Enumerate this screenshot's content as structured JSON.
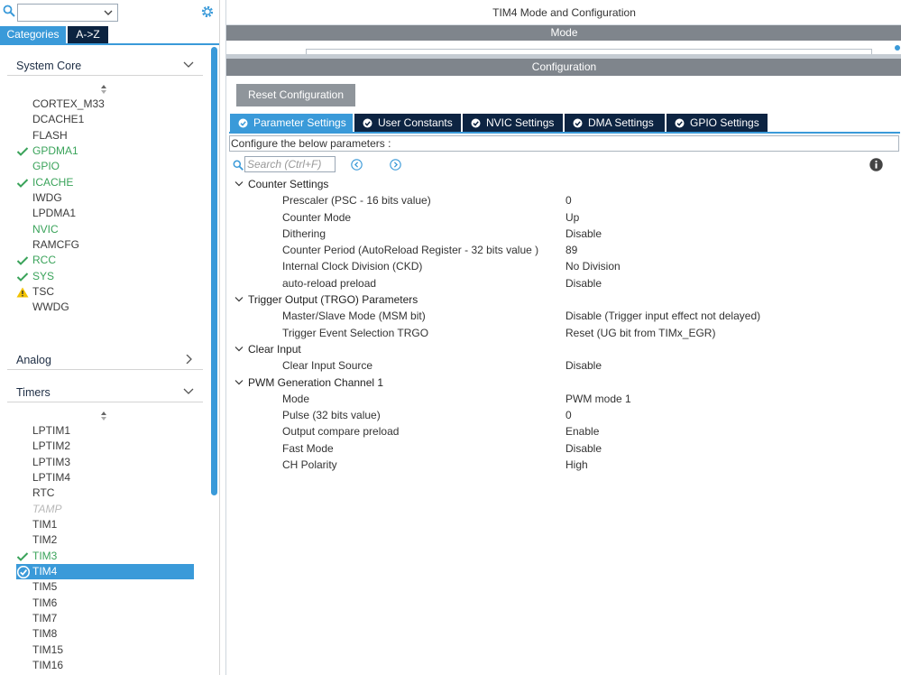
{
  "left": {
    "search": {
      "value": ""
    },
    "tabs": [
      {
        "label": "Categories"
      },
      {
        "label": "A->Z"
      }
    ],
    "sections": {
      "system_core": {
        "title": "System Core",
        "items": [
          {
            "label": "CORTEX_M33",
            "state": "normal"
          },
          {
            "label": "DCACHE1",
            "state": "normal"
          },
          {
            "label": "FLASH",
            "state": "normal"
          },
          {
            "label": "GPDMA1",
            "state": "ok"
          },
          {
            "label": "GPIO",
            "state": "ok-nocheck"
          },
          {
            "label": "ICACHE",
            "state": "ok"
          },
          {
            "label": "IWDG",
            "state": "normal"
          },
          {
            "label": "LPDMA1",
            "state": "normal"
          },
          {
            "label": "NVIC",
            "state": "ok-nocheck"
          },
          {
            "label": "RAMCFG",
            "state": "normal"
          },
          {
            "label": "RCC",
            "state": "ok"
          },
          {
            "label": "SYS",
            "state": "ok"
          },
          {
            "label": "TSC",
            "state": "warning"
          },
          {
            "label": "WWDG",
            "state": "normal"
          }
        ]
      },
      "analog": {
        "title": "Analog"
      },
      "timers": {
        "title": "Timers",
        "items": [
          {
            "label": "LPTIM1",
            "state": "normal"
          },
          {
            "label": "LPTIM2",
            "state": "normal"
          },
          {
            "label": "LPTIM3",
            "state": "normal"
          },
          {
            "label": "LPTIM4",
            "state": "normal"
          },
          {
            "label": "RTC",
            "state": "normal"
          },
          {
            "label": "TAMP",
            "state": "disabled"
          },
          {
            "label": "TIM1",
            "state": "normal"
          },
          {
            "label": "TIM2",
            "state": "normal"
          },
          {
            "label": "TIM3",
            "state": "ok"
          },
          {
            "label": "TIM4",
            "state": "selected"
          },
          {
            "label": "TIM5",
            "state": "normal"
          },
          {
            "label": "TIM6",
            "state": "normal"
          },
          {
            "label": "TIM7",
            "state": "normal"
          },
          {
            "label": "TIM8",
            "state": "normal"
          },
          {
            "label": "TIM15",
            "state": "normal"
          },
          {
            "label": "TIM16",
            "state": "normal"
          }
        ]
      }
    }
  },
  "right": {
    "title": "TIM4 Mode and Configuration",
    "mode_label": "Mode",
    "config_label": "Configuration",
    "reset_label": "Reset Configuration",
    "tabs": [
      {
        "label": "Parameter Settings"
      },
      {
        "label": "User Constants"
      },
      {
        "label": "NVIC Settings"
      },
      {
        "label": "DMA Settings"
      },
      {
        "label": "GPIO Settings"
      }
    ],
    "description": "Configure the below parameters :",
    "search_placeholder": "Search (Ctrl+F)",
    "groups": [
      {
        "title": "Counter Settings",
        "params": [
          {
            "name": "Prescaler (PSC - 16 bits value)",
            "value": "0"
          },
          {
            "name": "Counter Mode",
            "value": "Up"
          },
          {
            "name": "Dithering",
            "value": "Disable"
          },
          {
            "name": "Counter Period (AutoReload Register - 32 bits value )",
            "value": "89"
          },
          {
            "name": "Internal Clock Division (CKD)",
            "value": "No Division"
          },
          {
            "name": "auto-reload preload",
            "value": "Disable"
          }
        ]
      },
      {
        "title": "Trigger Output (TRGO) Parameters",
        "params": [
          {
            "name": "Master/Slave Mode (MSM bit)",
            "value": "Disable (Trigger input effect not delayed)"
          },
          {
            "name": "Trigger Event Selection TRGO",
            "value": "Reset (UG bit from TIMx_EGR)"
          }
        ]
      },
      {
        "title": "Clear Input",
        "params": [
          {
            "name": "Clear Input Source",
            "value": "Disable"
          }
        ]
      },
      {
        "title": "PWM Generation Channel 1",
        "params": [
          {
            "name": "Mode",
            "value": "PWM mode 1"
          },
          {
            "name": "Pulse (32 bits value)",
            "value": "0"
          },
          {
            "name": "Output compare preload",
            "value": "Enable"
          },
          {
            "name": "Fast Mode",
            "value": "Disable"
          },
          {
            "name": "CH Polarity",
            "value": "High"
          }
        ]
      }
    ]
  },
  "colors": {
    "accent": "#3a9ad9",
    "tab_dark": "#0d2442",
    "bar_gray": "#7f858c",
    "ok_green": "#3aa35a",
    "warning": "#f2c200"
  }
}
